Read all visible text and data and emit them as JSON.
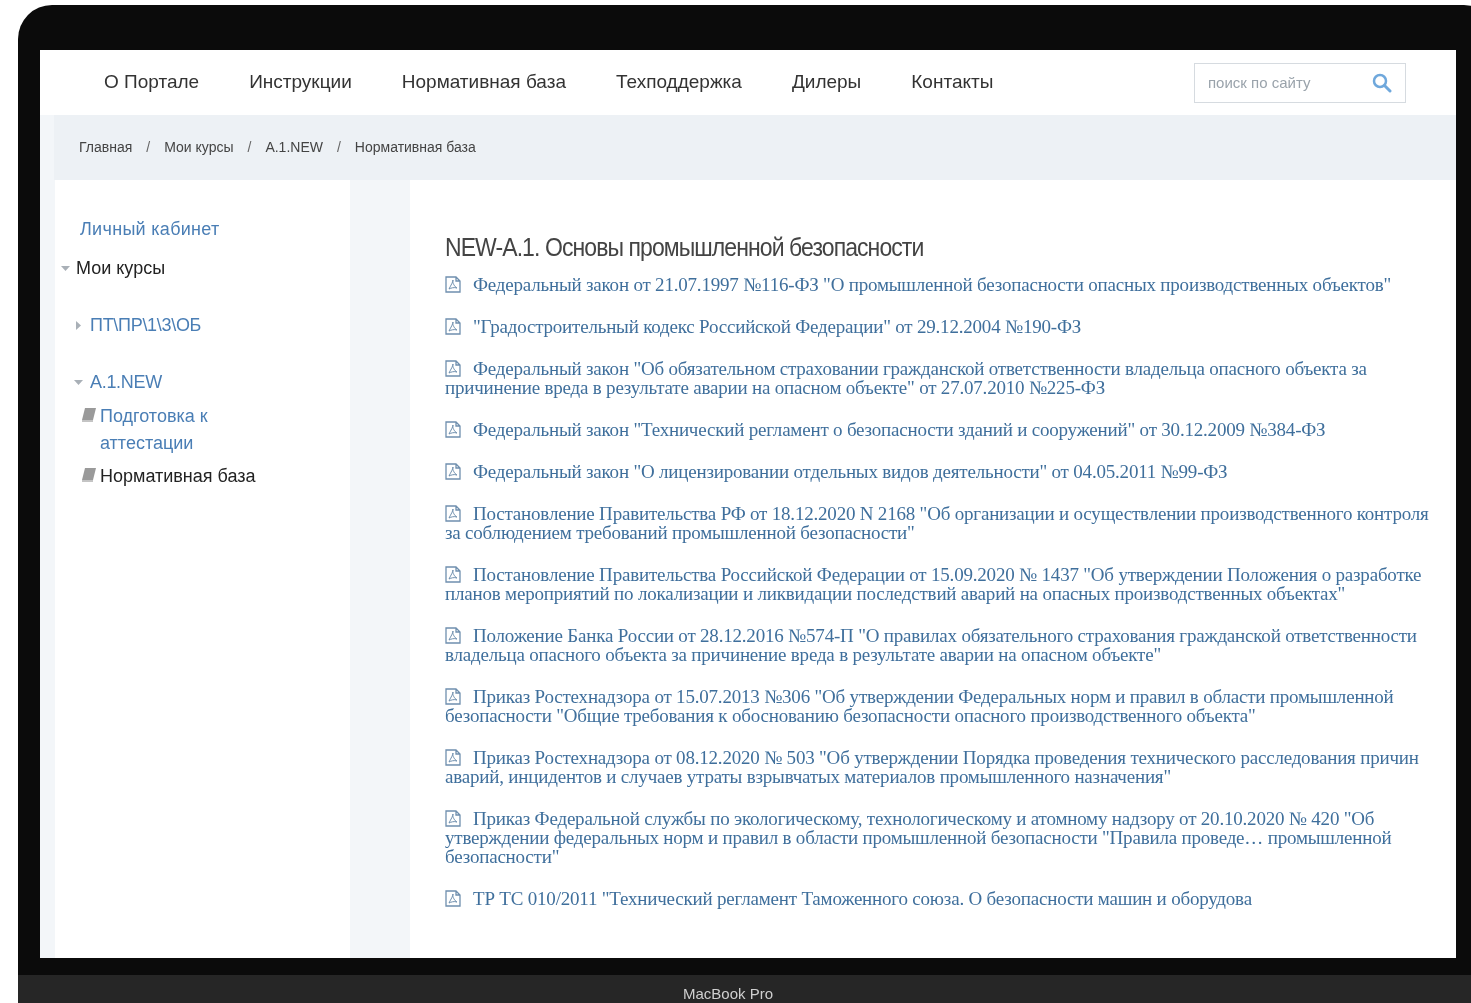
{
  "nav": {
    "items": [
      "О Портале",
      "Инструкции",
      "Нормативная база",
      "Техподдержка",
      "Дилеры",
      "Контакты"
    ],
    "search": {
      "placeholder": "поиск по сайту"
    }
  },
  "breadcrumbs": {
    "items": [
      "Главная",
      "Мои курсы",
      "A.1.NEW",
      "Нормативная база"
    ],
    "separators": [
      "/",
      "/",
      "/"
    ]
  },
  "sidebar": {
    "account_link": "Личный кабинет",
    "tree": [
      {
        "label": "Мои курсы",
        "kind": "section",
        "expanded": true,
        "children": [
          {
            "label": "ПТ\\ПР\\1\\3\\ОБ",
            "kind": "folder",
            "expanded": false
          },
          {
            "label": "A.1.NEW",
            "kind": "folder",
            "expanded": true,
            "children": [
              {
                "label": "Подготовка к аттестации",
                "kind": "page",
                "selected": false
              },
              {
                "label": "Нормативная база",
                "kind": "page",
                "selected": true
              }
            ]
          }
        ]
      }
    ]
  },
  "main": {
    "title": "NEW-A.1. Основы промышленной безопасности",
    "documents": [
      "Федеральный закон от 21.07.1997 №116-ФЗ \"О промышленной безопасности опасных производственных объектов\"",
      "\"Градостроительный кодекс Российской Федерации\" от 29.12.2004 №190-ФЗ",
      "Федеральный закон \"Об обязательном страховании гражданской ответственности владельца опасного объекта за причинение вреда в результате аварии на опасном объекте\" от 27.07.2010 №225-ФЗ",
      "Федеральный закон \"Технический регламент о безопасности зданий и сооружений\" от 30.12.2009 №384-ФЗ",
      "Федеральный закон \"О лицензировании отдельных видов деятельности\" от 04.05.2011 №99-ФЗ",
      "Постановление Правительства РФ от 18.12.2020 N 2168 \"Об организации и осуществлении производственного контроля за соблюдением требований промышленной безопасности\"",
      "Постановление Правительства Российской Федерации от 15.09.2020 № 1437 \"Об утверждении Положения о разработке планов мероприятий по локализации и ликвидации последствий аварий на опасных производственных объектах\"",
      "Положение Банка России от 28.12.2016 №574-П \"О правилах обязательного страхования гражданской ответственности владельца опасного объекта за причинение вреда в результате аварии на опасном объекте\"",
      "Приказ Ростехнадзора от 15.07.2013 №306 \"Об утверждении Федеральных норм и правил в области промышленной безопасности \"Общие требования к обоснованию безопасности опасного производственного объекта\"",
      "Приказ Ростехнадзора от 08.12.2020 № 503 \"Об утверждении Порядка проведения технического расследования причин аварий, инцидентов и случаев утраты взрывчатых материалов промышленного назначения\"",
      "Приказ Федеральной службы по экологическому, технологическому и атомному надзору от 20.10.2020 № 420 \"Об утверждении федеральных норм и правил в области промышленной безопасности \"Правила проведе… промышленной безопасности\"",
      "ТР ТС 010/2011 \"Технический регламент Таможенного союза. О безопасности машин и оборудова"
    ]
  },
  "device_label": "MacBook Pro"
}
